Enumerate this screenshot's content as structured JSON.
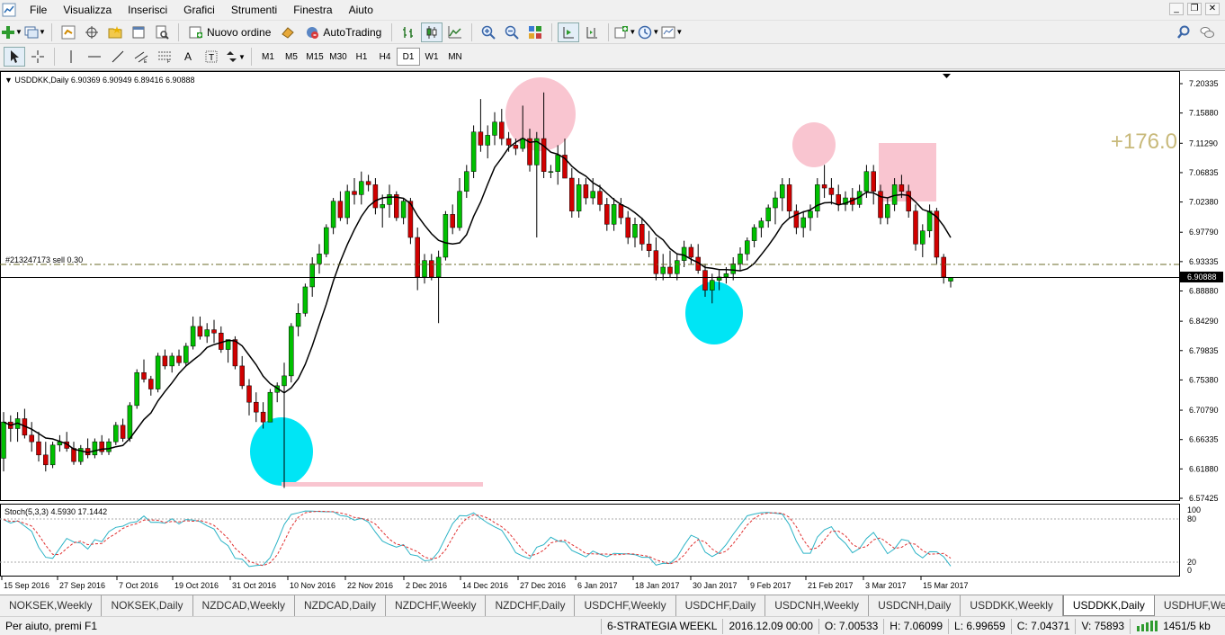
{
  "menu": [
    "File",
    "Visualizza",
    "Inserisci",
    "Grafici",
    "Strumenti",
    "Finestra",
    "Aiuto"
  ],
  "toolbar": {
    "new_order": "Nuovo ordine",
    "autotrading": "AutoTrading"
  },
  "timeframes": [
    "M1",
    "M5",
    "M15",
    "M30",
    "H1",
    "H4",
    "D1",
    "W1",
    "MN"
  ],
  "active_timeframe": "D1",
  "chart": {
    "header": "USDDKK,Daily  6.90369 6.90949 6.89416 6.90888",
    "order_label": "#213247173 sell 0.30",
    "profit_label": "+176.0",
    "current_price": "6.90888",
    "price_ticks": [
      "7.20335",
      "7.15880",
      "7.11290",
      "7.06835",
      "7.02380",
      "6.97790",
      "6.93335",
      "6.88880",
      "6.84290",
      "6.79835",
      "6.75380",
      "6.70790",
      "6.66335",
      "6.61880",
      "6.57425"
    ],
    "date_labels": [
      "15 Sep 2016",
      "27 Sep 2016",
      "7 Oct 2016",
      "19 Oct 2016",
      "31 Oct 2016",
      "10 Nov 2016",
      "22 Nov 2016",
      "2 Dec 2016",
      "14 Dec 2016",
      "27 Dec 2016",
      "6 Jan 2017",
      "18 Jan 2017",
      "30 Jan 2017",
      "9 Feb 2017",
      "21 Feb 2017",
      "3 Mar 2017",
      "15 Mar 2017"
    ],
    "indicator_header": "Stoch(5,3,3) 4.5930 17.1442",
    "indicator_ticks": [
      "100",
      "80",
      "20",
      "0"
    ]
  },
  "chart_data": {
    "type": "candlestick",
    "symbol": "USDDKK",
    "timeframe": "Daily",
    "ylim": [
      6.57425,
      7.20335
    ],
    "candles_ohlc": [
      [
        6.635,
        6.705,
        6.615,
        6.69
      ],
      [
        6.69,
        6.7,
        6.66,
        6.68
      ],
      [
        6.68,
        6.705,
        6.66,
        6.695
      ],
      [
        6.695,
        6.71,
        6.665,
        6.67
      ],
      [
        6.67,
        6.69,
        6.645,
        6.66
      ],
      [
        6.66,
        6.675,
        6.63,
        6.64
      ],
      [
        6.64,
        6.66,
        6.615,
        6.625
      ],
      [
        6.625,
        6.66,
        6.62,
        6.655
      ],
      [
        6.655,
        6.67,
        6.645,
        6.66
      ],
      [
        6.66,
        6.675,
        6.645,
        6.65
      ],
      [
        6.65,
        6.66,
        6.625,
        6.63
      ],
      [
        6.63,
        6.655,
        6.625,
        6.65
      ],
      [
        6.65,
        6.665,
        6.635,
        6.64
      ],
      [
        6.64,
        6.665,
        6.635,
        6.66
      ],
      [
        6.66,
        6.67,
        6.64,
        6.645
      ],
      [
        6.645,
        6.665,
        6.64,
        6.66
      ],
      [
        6.66,
        6.69,
        6.655,
        6.685
      ],
      [
        6.685,
        6.695,
        6.66,
        6.665
      ],
      [
        6.665,
        6.72,
        6.66,
        6.715
      ],
      [
        6.715,
        6.77,
        6.71,
        6.765
      ],
      [
        6.765,
        6.785,
        6.75,
        6.755
      ],
      [
        6.755,
        6.76,
        6.73,
        6.74
      ],
      [
        6.74,
        6.795,
        6.735,
        6.79
      ],
      [
        6.79,
        6.8,
        6.77,
        6.775
      ],
      [
        6.775,
        6.795,
        6.765,
        6.79
      ],
      [
        6.79,
        6.8,
        6.775,
        6.78
      ],
      [
        6.78,
        6.81,
        6.775,
        6.805
      ],
      [
        6.805,
        6.85,
        6.8,
        6.835
      ],
      [
        6.835,
        6.85,
        6.815,
        6.82
      ],
      [
        6.82,
        6.84,
        6.81,
        6.83
      ],
      [
        6.83,
        6.845,
        6.81,
        6.825
      ],
      [
        6.825,
        6.835,
        6.795,
        6.8
      ],
      [
        6.8,
        6.815,
        6.78,
        6.815
      ],
      [
        6.815,
        6.82,
        6.77,
        6.775
      ],
      [
        6.775,
        6.79,
        6.74,
        6.745
      ],
      [
        6.745,
        6.755,
        6.7,
        6.72
      ],
      [
        6.72,
        6.735,
        6.69,
        6.705
      ],
      [
        6.705,
        6.72,
        6.68,
        6.69
      ],
      [
        6.69,
        6.74,
        6.69,
        6.735
      ],
      [
        6.735,
        6.75,
        6.72,
        6.745
      ],
      [
        6.745,
        6.78,
        6.59,
        6.76
      ],
      [
        6.76,
        6.84,
        6.75,
        6.835
      ],
      [
        6.835,
        6.87,
        6.82,
        6.855
      ],
      [
        6.855,
        6.9,
        6.85,
        6.895
      ],
      [
        6.895,
        6.94,
        6.88,
        6.93
      ],
      [
        6.93,
        6.96,
        6.915,
        6.945
      ],
      [
        6.945,
        6.99,
        6.94,
        6.985
      ],
      [
        6.985,
        7.03,
        6.975,
        7.025
      ],
      [
        7.025,
        7.04,
        6.995,
        7.0
      ],
      [
        7.0,
        7.05,
        6.99,
        7.04
      ],
      [
        7.04,
        7.06,
        7.02,
        7.035
      ],
      [
        7.035,
        7.07,
        7.02,
        7.055
      ],
      [
        7.055,
        7.065,
        7.04,
        7.05
      ],
      [
        7.05,
        7.06,
        7.005,
        7.015
      ],
      [
        7.015,
        7.035,
        6.985,
        7.02
      ],
      [
        7.02,
        7.05,
        7.0,
        7.035
      ],
      [
        7.035,
        7.04,
        6.995,
        7.0
      ],
      [
        7.0,
        7.03,
        6.99,
        7.025
      ],
      [
        7.025,
        7.03,
        6.96,
        6.97
      ],
      [
        6.97,
        6.985,
        6.89,
        6.91
      ],
      [
        6.91,
        6.945,
        6.9,
        6.935
      ],
      [
        6.935,
        6.945,
        6.905,
        6.91
      ],
      [
        6.91,
        6.95,
        6.84,
        6.94
      ],
      [
        6.94,
        7.01,
        6.935,
        7.005
      ],
      [
        7.005,
        7.02,
        6.975,
        6.985
      ],
      [
        6.985,
        7.06,
        6.98,
        7.04
      ],
      [
        7.04,
        7.08,
        7.03,
        7.07
      ],
      [
        7.07,
        7.14,
        7.06,
        7.13
      ],
      [
        7.13,
        7.18,
        7.1,
        7.11
      ],
      [
        7.11,
        7.14,
        7.09,
        7.125
      ],
      [
        7.125,
        7.16,
        7.11,
        7.145
      ],
      [
        7.145,
        7.165,
        7.11,
        7.12
      ],
      [
        7.12,
        7.13,
        7.1,
        7.11
      ],
      [
        7.11,
        7.12,
        7.095,
        7.105
      ],
      [
        7.105,
        7.17,
        7.1,
        7.12
      ],
      [
        7.12,
        7.135,
        7.07,
        7.08
      ],
      [
        7.08,
        7.13,
        6.97,
        7.12
      ],
      [
        7.12,
        7.19,
        7.06,
        7.07
      ],
      [
        7.07,
        7.08,
        7.06,
        7.07
      ],
      [
        7.07,
        7.11,
        7.05,
        7.095
      ],
      [
        7.095,
        7.12,
        7.08,
        7.06
      ],
      [
        7.06,
        7.075,
        7.0,
        7.01
      ],
      [
        7.01,
        7.06,
        7.0,
        7.05
      ],
      [
        7.05,
        7.06,
        7.02,
        7.03
      ],
      [
        7.03,
        7.06,
        7.02,
        7.04
      ],
      [
        7.04,
        7.05,
        7.01,
        7.02
      ],
      [
        7.02,
        7.03,
        6.98,
        6.99
      ],
      [
        6.99,
        7.03,
        6.98,
        7.02
      ],
      [
        7.02,
        7.03,
        6.99,
        7.0
      ],
      [
        7.0,
        7.01,
        6.96,
        6.97
      ],
      [
        6.97,
        7.0,
        6.955,
        6.99
      ],
      [
        6.99,
        7.0,
        6.95,
        6.96
      ],
      [
        6.96,
        6.98,
        6.94,
        6.95
      ],
      [
        6.95,
        6.97,
        6.905,
        6.915
      ],
      [
        6.915,
        6.945,
        6.905,
        6.925
      ],
      [
        6.925,
        6.95,
        6.91,
        6.915
      ],
      [
        6.915,
        6.945,
        6.905,
        6.935
      ],
      [
        6.935,
        6.965,
        6.925,
        6.955
      ],
      [
        6.955,
        6.96,
        6.93,
        6.94
      ],
      [
        6.94,
        6.96,
        6.915,
        6.92
      ],
      [
        6.92,
        6.93,
        6.88,
        6.89
      ],
      [
        6.89,
        6.915,
        6.87,
        6.905
      ],
      [
        6.905,
        6.92,
        6.89,
        6.91
      ],
      [
        6.91,
        6.925,
        6.9,
        6.915
      ],
      [
        6.915,
        6.94,
        6.905,
        6.93
      ],
      [
        6.93,
        6.955,
        6.92,
        6.945
      ],
      [
        6.945,
        6.97,
        6.935,
        6.965
      ],
      [
        6.965,
        6.99,
        6.955,
        6.985
      ],
      [
        6.985,
        7.0,
        6.97,
        6.995
      ],
      [
        6.995,
        7.02,
        6.985,
        7.015
      ],
      [
        7.015,
        7.04,
        6.99,
        7.03
      ],
      [
        7.03,
        7.06,
        7.01,
        7.05
      ],
      [
        7.05,
        7.06,
        7.0,
        7.01
      ],
      [
        7.01,
        7.02,
        6.975,
        6.985
      ],
      [
        6.985,
        7.01,
        6.97,
        7.0
      ],
      [
        7.0,
        7.02,
        6.98,
        7.01
      ],
      [
        7.01,
        7.06,
        7.0,
        7.05
      ],
      [
        7.05,
        7.08,
        7.03,
        7.045
      ],
      [
        7.045,
        7.06,
        7.02,
        7.035
      ],
      [
        7.035,
        7.05,
        7.01,
        7.02
      ],
      [
        7.02,
        7.04,
        7.01,
        7.03
      ],
      [
        7.03,
        7.045,
        7.01,
        7.02
      ],
      [
        7.02,
        7.05,
        7.015,
        7.04
      ],
      [
        7.04,
        7.08,
        7.03,
        7.07
      ],
      [
        7.07,
        7.08,
        7.02,
        7.04
      ],
      [
        7.04,
        7.05,
        6.99,
        7.0
      ],
      [
        7.0,
        7.03,
        6.99,
        7.02
      ],
      [
        7.02,
        7.06,
        7.01,
        7.05
      ],
      [
        7.05,
        7.065,
        7.03,
        7.04
      ],
      [
        7.04,
        7.05,
        7.0,
        7.01
      ],
      [
        7.01,
        7.02,
        6.95,
        6.96
      ],
      [
        6.96,
        6.99,
        6.94,
        6.98
      ],
      [
        6.98,
        7.02,
        6.97,
        7.01
      ],
      [
        7.01,
        7.015,
        6.93,
        6.94
      ],
      [
        6.94,
        6.945,
        6.9,
        6.91
      ],
      [
        6.90369,
        6.90949,
        6.89416,
        6.90888
      ]
    ]
  }
}
